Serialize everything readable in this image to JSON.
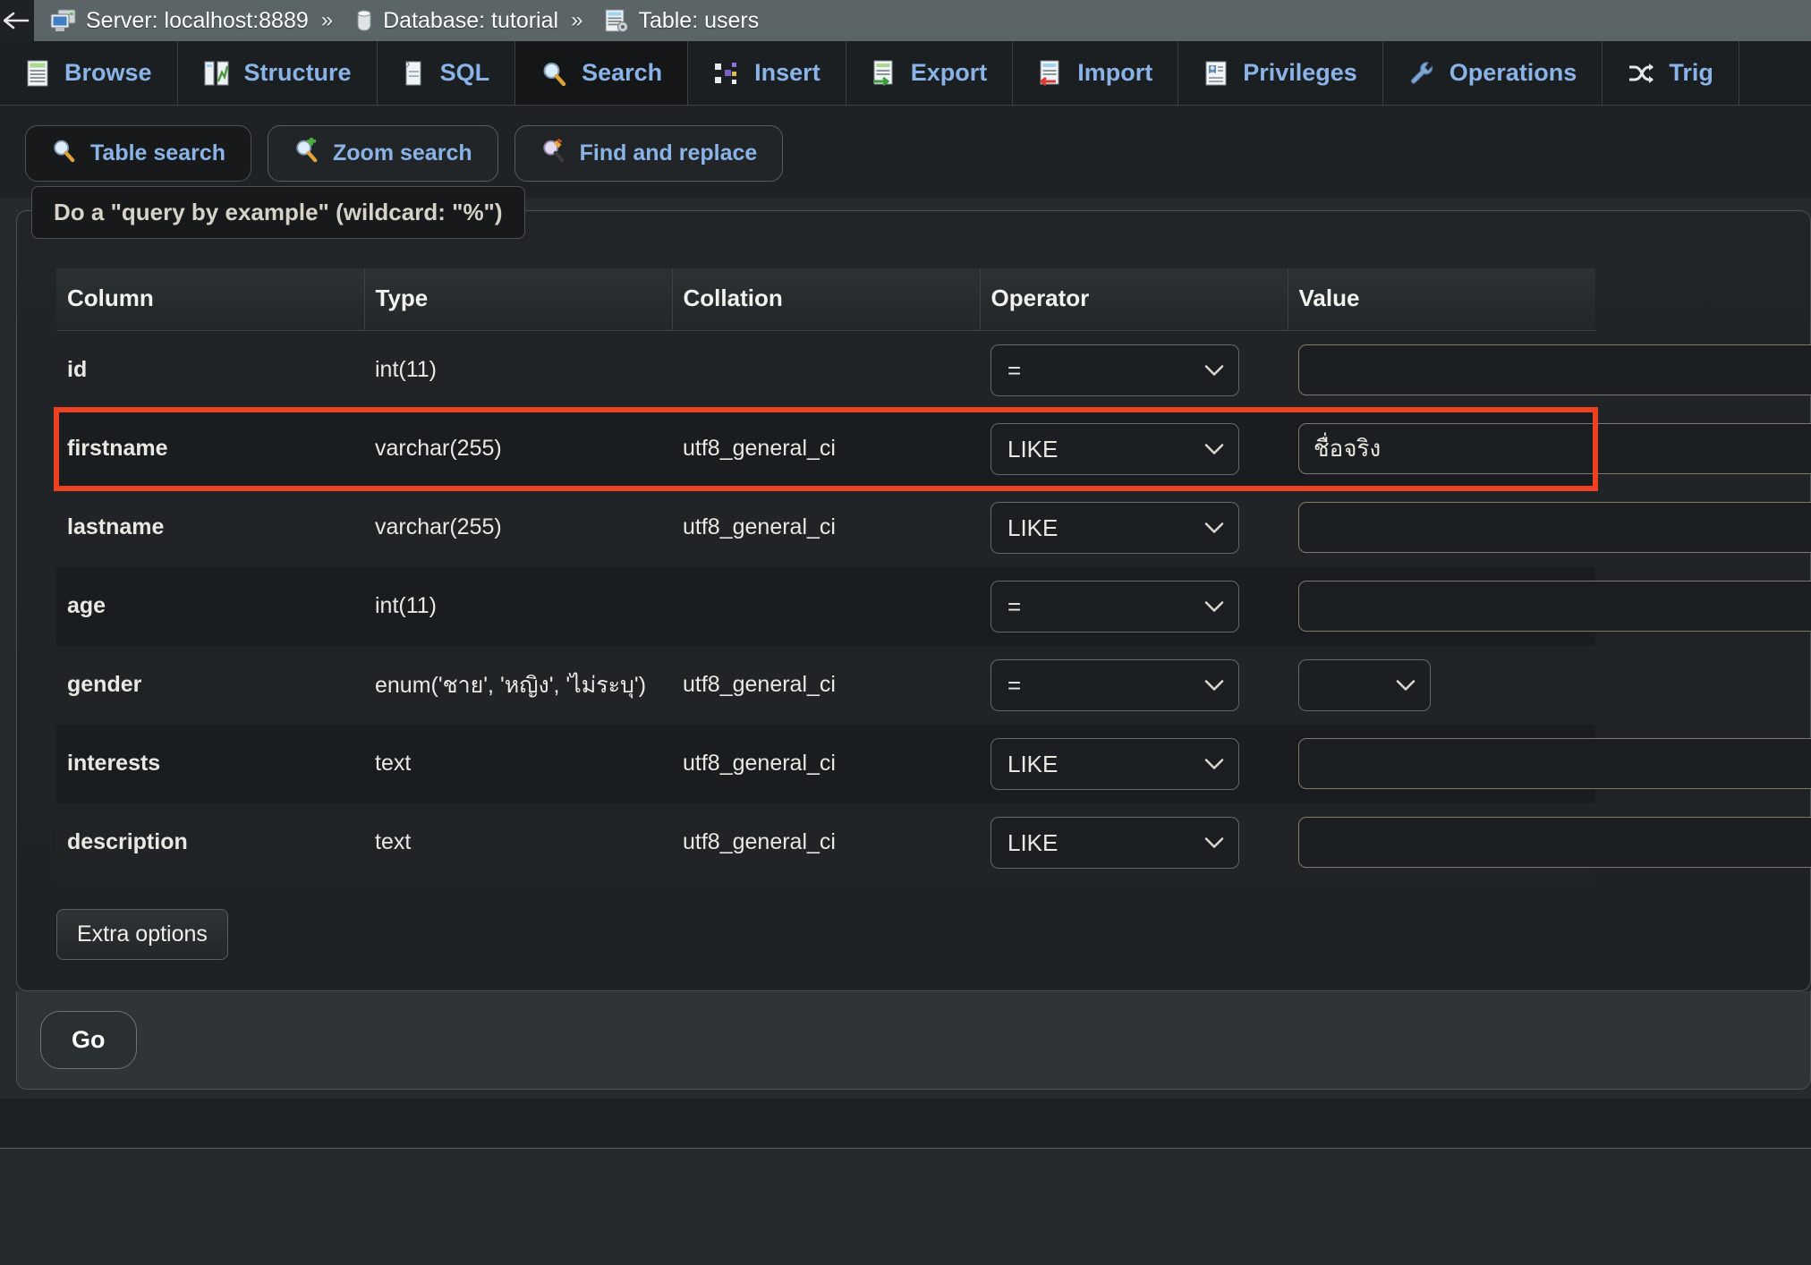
{
  "breadcrumb": {
    "back_label": "back",
    "server": "Server: localhost:8889",
    "database": "Database: tutorial",
    "table": "Table: users",
    "separator": "»"
  },
  "main_tabs": [
    {
      "label": "Browse",
      "icon": "browse-icon",
      "active": false
    },
    {
      "label": "Structure",
      "icon": "structure-icon",
      "active": false
    },
    {
      "label": "SQL",
      "icon": "sql-icon",
      "active": false
    },
    {
      "label": "Search",
      "icon": "search-icon",
      "active": true
    },
    {
      "label": "Insert",
      "icon": "insert-icon",
      "active": false
    },
    {
      "label": "Export",
      "icon": "export-icon",
      "active": false
    },
    {
      "label": "Import",
      "icon": "import-icon",
      "active": false
    },
    {
      "label": "Privileges",
      "icon": "privileges-icon",
      "active": false
    },
    {
      "label": "Operations",
      "icon": "operations-icon",
      "active": false
    },
    {
      "label": "Trig",
      "icon": "triggers-icon",
      "active": false
    }
  ],
  "sub_tabs": [
    {
      "label": "Table search",
      "icon": "magnifier-icon",
      "active": true
    },
    {
      "label": "Zoom search",
      "icon": "magnifier-plus-icon",
      "active": false
    },
    {
      "label": "Find and replace",
      "icon": "magnifier-pen-icon",
      "active": false
    }
  ],
  "fieldset": {
    "legend": "Do a \"query by example\" (wildcard: \"%\")"
  },
  "table": {
    "headers": [
      "Column",
      "Type",
      "Collation",
      "Operator",
      "Value"
    ],
    "rows": [
      {
        "column": "id",
        "type": "int(11)",
        "collation": "",
        "operator": "=",
        "value": "",
        "value_kind": "text",
        "highlight": false
      },
      {
        "column": "firstname",
        "type": "varchar(255)",
        "collation": "utf8_general_ci",
        "operator": "LIKE",
        "value": "ชื่อจริง",
        "value_kind": "text",
        "highlight": true
      },
      {
        "column": "lastname",
        "type": "varchar(255)",
        "collation": "utf8_general_ci",
        "operator": "LIKE",
        "value": "",
        "value_kind": "text",
        "highlight": false
      },
      {
        "column": "age",
        "type": "int(11)",
        "collation": "",
        "operator": "=",
        "value": "",
        "value_kind": "text",
        "highlight": false
      },
      {
        "column": "gender",
        "type": "enum('ชาย', 'หญิง', 'ไม่ระบุ')",
        "collation": "utf8_general_ci",
        "operator": "=",
        "value": "",
        "value_kind": "select",
        "highlight": false
      },
      {
        "column": "interests",
        "type": "text",
        "collation": "utf8_general_ci",
        "operator": "LIKE",
        "value": "",
        "value_kind": "text",
        "highlight": false
      },
      {
        "column": "description",
        "type": "text",
        "collation": "utf8_general_ci",
        "operator": "LIKE",
        "value": "",
        "value_kind": "text",
        "highlight": false
      }
    ]
  },
  "actions": {
    "extra_options": "Extra options",
    "go": "Go"
  },
  "colors": {
    "highlight_outline": "#ee4122",
    "tab_link": "#8ab4e8",
    "breadcrumb_bg": "#5b6467",
    "page_bg": "#262a2c"
  }
}
